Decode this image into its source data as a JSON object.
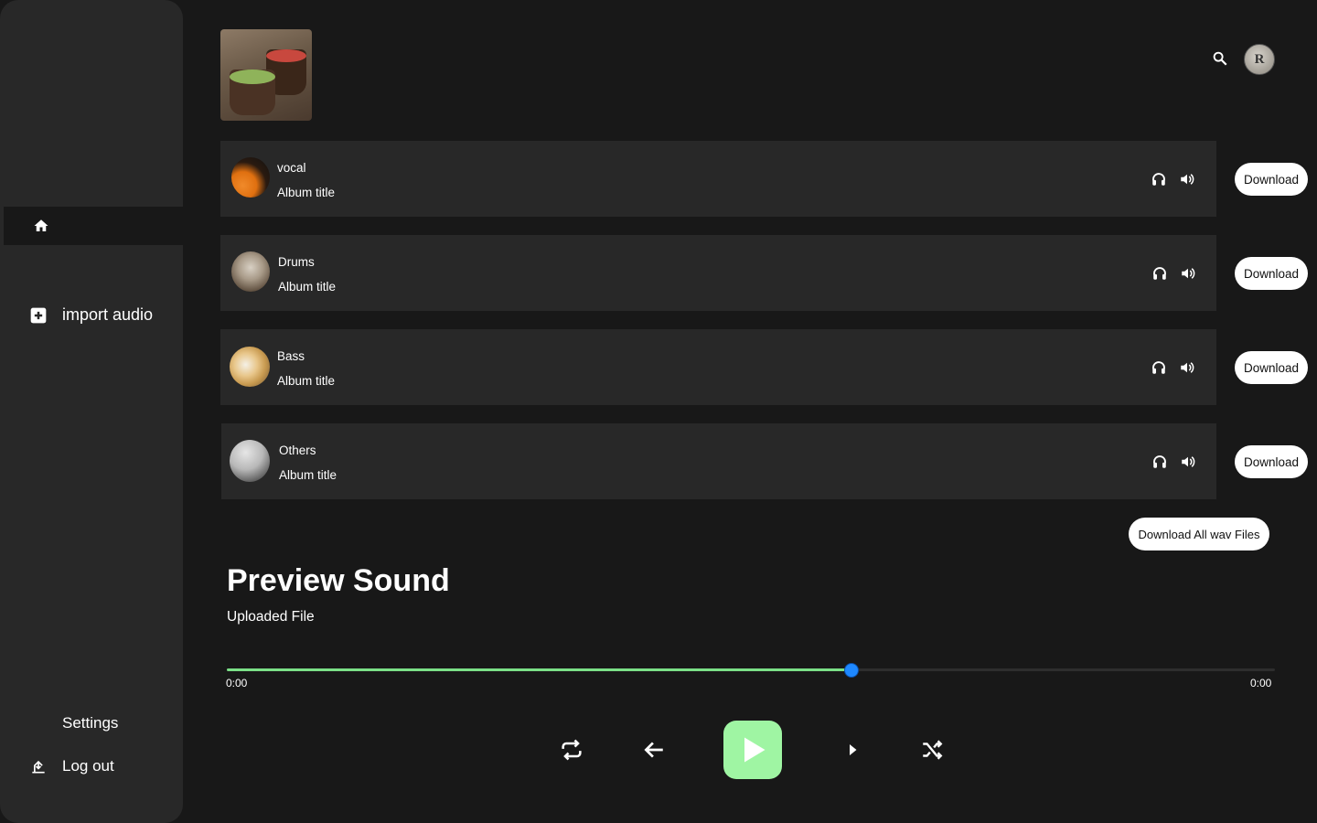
{
  "sidebar": {
    "home_icon": "home-icon",
    "import_label": "import audio",
    "import_icon": "plus-square-icon",
    "settings_label": "Settings",
    "logout_label": "Log out",
    "logout_icon": "logout-icon"
  },
  "header": {
    "search_icon": "search-icon",
    "avatar_letter": "R"
  },
  "tracks": [
    {
      "name": "vocal",
      "subtitle": "Album title",
      "download_label": "Download"
    },
    {
      "name": "Drums",
      "subtitle": "Album title",
      "download_label": "Download"
    },
    {
      "name": "Bass",
      "subtitle": "Album title",
      "download_label": "Download"
    },
    {
      "name": "Others",
      "subtitle": "Album title",
      "download_label": "Download"
    }
  ],
  "download_all_label": "Download All wav Files",
  "preview": {
    "title": "Preview Sound",
    "subtitle": "Uploaded File",
    "progress": 0.595,
    "time_start": "0:00",
    "time_end": "0:00"
  },
  "colors": {
    "background": "#181818",
    "sidebar": "#282828",
    "accent_green": "#9ff5a3",
    "progress_green": "#7be087",
    "knob_blue": "#1e88ff"
  },
  "controls": [
    "repeat-icon",
    "previous-arrow-icon",
    "play-icon",
    "next-icon",
    "shuffle-icon"
  ]
}
